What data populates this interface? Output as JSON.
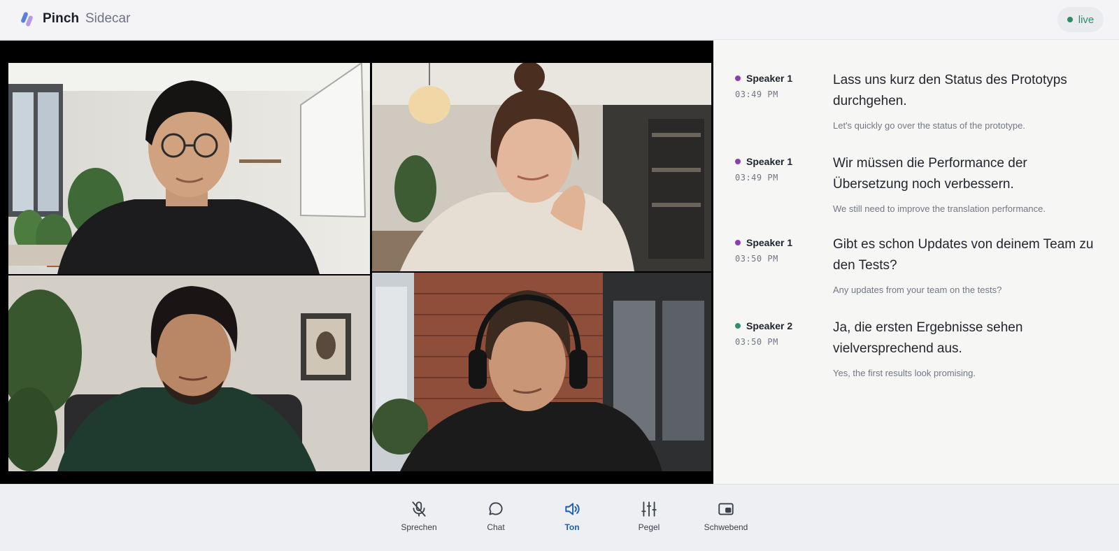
{
  "header": {
    "brand": "Pinch",
    "product": "Sidecar",
    "status": "live",
    "status_color": "#2e8b64",
    "logo_colors": [
      "#5a7de0",
      "#b79ae6"
    ]
  },
  "video": {
    "participants": [
      {
        "tile": 1,
        "scene": "man with glasses in bright office with whiteboard and plants"
      },
      {
        "tile": 2,
        "scene": "woman with hair bun, hand on chin, cozy room with paper lamp"
      },
      {
        "tile": 3,
        "scene": "curly-haired man in green hoodie, plant and framed picture behind"
      },
      {
        "tile": 4,
        "scene": "man wearing headphones in brick-walled office"
      }
    ]
  },
  "transcript": {
    "entries": [
      {
        "speaker": "Speaker 1",
        "speaker_color": "#8a3fb0",
        "time": "03:49 PM",
        "original": "Lass uns kurz den Status des Prototyps durchgehen.",
        "translation": "Let's quickly go over the status of the prototype."
      },
      {
        "speaker": "Speaker 1",
        "speaker_color": "#8a3fb0",
        "time": "03:49 PM",
        "original": "Wir müssen die Performance der Übersetzung noch verbessern.",
        "translation": "We still need to improve the translation performance."
      },
      {
        "speaker": "Speaker 1",
        "speaker_color": "#8a3fb0",
        "time": "03:50 PM",
        "original": "Gibt es schon Updates von deinem Team zu den Tests?",
        "translation": "Any updates from your team on the tests?"
      },
      {
        "speaker": "Speaker 2",
        "speaker_color": "#2f8f6d",
        "time": "03:50 PM",
        "original": "Ja, die ersten Ergebnisse sehen vielversprechend aus.",
        "translation": "Yes, the first results look promising."
      }
    ]
  },
  "toolbar": {
    "active": "Ton",
    "active_color": "#1b5fa8",
    "items": [
      {
        "label": "Sprechen",
        "icon": "mic-off-icon"
      },
      {
        "label": "Chat",
        "icon": "chat-bubble-icon"
      },
      {
        "label": "Ton",
        "icon": "speaker-icon"
      },
      {
        "label": "Pegel",
        "icon": "sliders-icon"
      },
      {
        "label": "Schwebend",
        "icon": "picture-in-picture-icon"
      }
    ]
  }
}
